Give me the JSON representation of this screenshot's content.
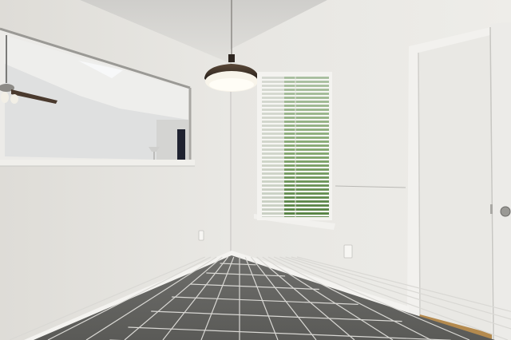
{
  "scene": {
    "description_free": true,
    "palette": {
      "wall_left": "#e4e3df",
      "wall_back": "#eceae6",
      "wall_right": "#dcdbd7",
      "ceiling": "#d9d8d4",
      "floor_tile": "#6b6b68",
      "grout": "#d6d5d1",
      "baseboard": "#f4f3f0",
      "window_green": "#5f8a4a",
      "lamp_shade": "#4b3c30"
    },
    "icons": [
      "pendant-lamp-icon",
      "ceiling-fan-icon",
      "window-blinds-icon",
      "door-icon",
      "outlet-icon",
      "door-knob-icon"
    ]
  }
}
